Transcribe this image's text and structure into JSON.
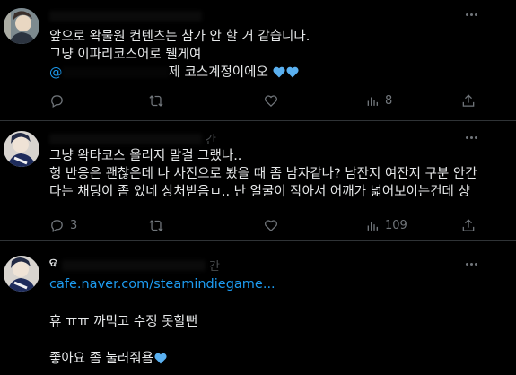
{
  "colors": {
    "background": "#000000",
    "text": "#e7e9ea",
    "muted": "#71767b",
    "link": "#1d9bf0",
    "divider": "#2f3336",
    "heart": "#5ab0f0"
  },
  "tweets": [
    {
      "lines": [
        "앞으로 왁물원 컨텐츠는 참가 안 할 거 같습니다.",
        "그냥 이파리코스어로 뷀게여"
      ],
      "mention_suffix": "제 코스계정이에오",
      "emoji": [
        "blue-heart-icon",
        "blue-heart-icon"
      ],
      "actions": {
        "reply": "",
        "retweet": "",
        "like": "",
        "views": "8"
      }
    },
    {
      "time_fragment": "간",
      "lines": [
        "그냥 왁타코스 올리지 말걸 그랬나..",
        "헝 반응은 괜찮은데 나 사진으로 봤을 때 좀 남자같나? 남잔지 여잔지 구분 안간",
        "다는 채팅이 좀 있네 상처받음ㅁ.. 난 얼굴이 작아서 어깨가 넓어보이는건데 샹"
      ],
      "actions": {
        "reply": "3",
        "retweet": "",
        "like": "",
        "views": "109"
      }
    },
    {
      "name_fragment": "ଦ",
      "time_fragment": "간",
      "link": "cafe.naver.com/steamindiegame...",
      "lines": [
        "휴 ㅠㅠ 까먹고 수정 못할뻔",
        "좋아요 좀 눌러줘욤"
      ],
      "emoji": [
        "blue-heart-icon"
      ]
    }
  ]
}
